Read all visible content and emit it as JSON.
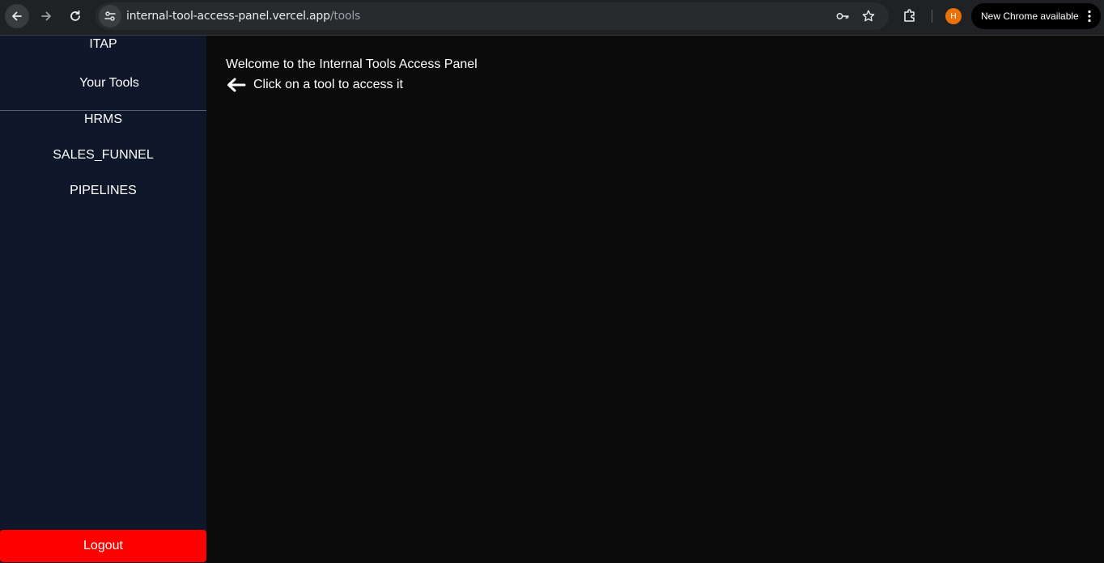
{
  "browser": {
    "url_host": "internal-tool-access-panel.vercel.app",
    "url_path": "/tools",
    "profile_initial": "H",
    "update_label": "New Chrome available",
    "icons": [
      "back-arrow-icon",
      "forward-arrow-icon",
      "reload-icon",
      "site-info-icon",
      "password-key-icon",
      "bookmark-star-icon",
      "extensions-puzzle-icon",
      "more-vert-icon"
    ]
  },
  "sidebar": {
    "brand": "ITAP",
    "section_title": "Your Tools",
    "tools": [
      {
        "label": "HRMS"
      },
      {
        "label": "SALES_FUNNEL"
      },
      {
        "label": "PIPELINES"
      }
    ],
    "logout_label": "Logout"
  },
  "main": {
    "welcome": "Welcome to the Internal Tools Access Panel",
    "hint": "Click on a tool to access it",
    "hint_icon": "left-arrow-icon"
  },
  "colors": {
    "sidebar_bg": "#0f172a",
    "main_bg": "#0b0b0b",
    "logout_bg": "#ff0000",
    "avatar_bg": "#e8710a"
  }
}
